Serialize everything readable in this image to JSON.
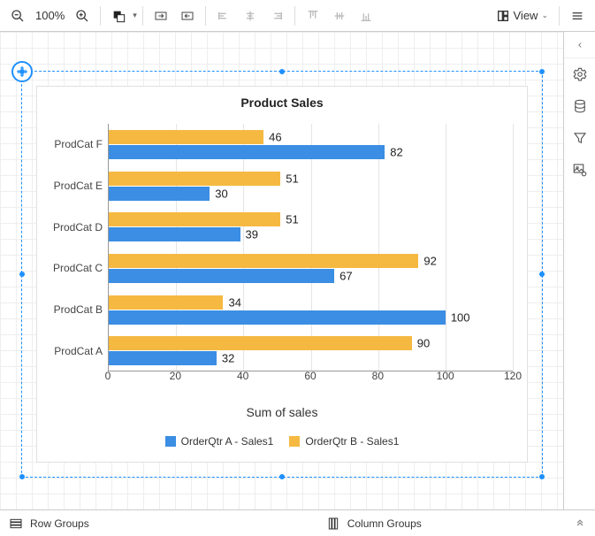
{
  "toolbar": {
    "zoom_pct": "100%",
    "view_label": "View"
  },
  "footer": {
    "row_groups_label": "Row Groups",
    "column_groups_label": "Column Groups"
  },
  "chart_data": {
    "type": "bar",
    "orientation": "horizontal",
    "title": "Product Sales",
    "xlabel": "Sum of sales",
    "ylabel": "",
    "categories": [
      "ProdCat A",
      "ProdCat B",
      "ProdCat C",
      "ProdCat D",
      "ProdCat E",
      "ProdCat F"
    ],
    "series": [
      {
        "name": "OrderQtr A - Sales1",
        "color": "#3b8ee3",
        "values": [
          32,
          100,
          67,
          39,
          30,
          82
        ]
      },
      {
        "name": "OrderQtr B - Sales1",
        "color": "#f5b942",
        "values": [
          90,
          34,
          92,
          51,
          51,
          46
        ]
      }
    ],
    "x_ticks": [
      0,
      20,
      40,
      60,
      80,
      100,
      120
    ],
    "xlim": [
      0,
      120
    ]
  }
}
